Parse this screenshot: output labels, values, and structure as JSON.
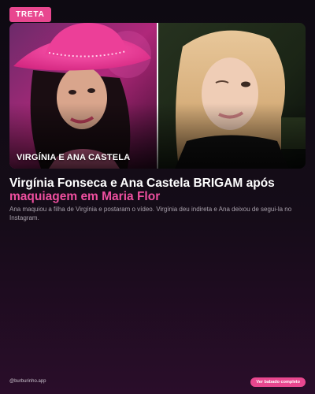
{
  "badge": {
    "label": "TRETA"
  },
  "photo": {
    "caption": "VIRGÍNIA E ANA CASTELA"
  },
  "headline": {
    "part1": "Virgínia Fonseca e Ana Castela BRIGAM após ",
    "part2": "maquiagem em Maria Flor"
  },
  "summary": "Ana maquiou a filha de Virgínia e postaram o vídeo. Virgínia deu indireta e Ana deixou de segui-la no Instagram.",
  "footer": {
    "handle": "@burburinho.app",
    "cta_label": "Ver babado completo"
  },
  "colors": {
    "accent": "#e8478f",
    "headline_accent": "#ee4f9f",
    "background": "#0e0a12"
  }
}
